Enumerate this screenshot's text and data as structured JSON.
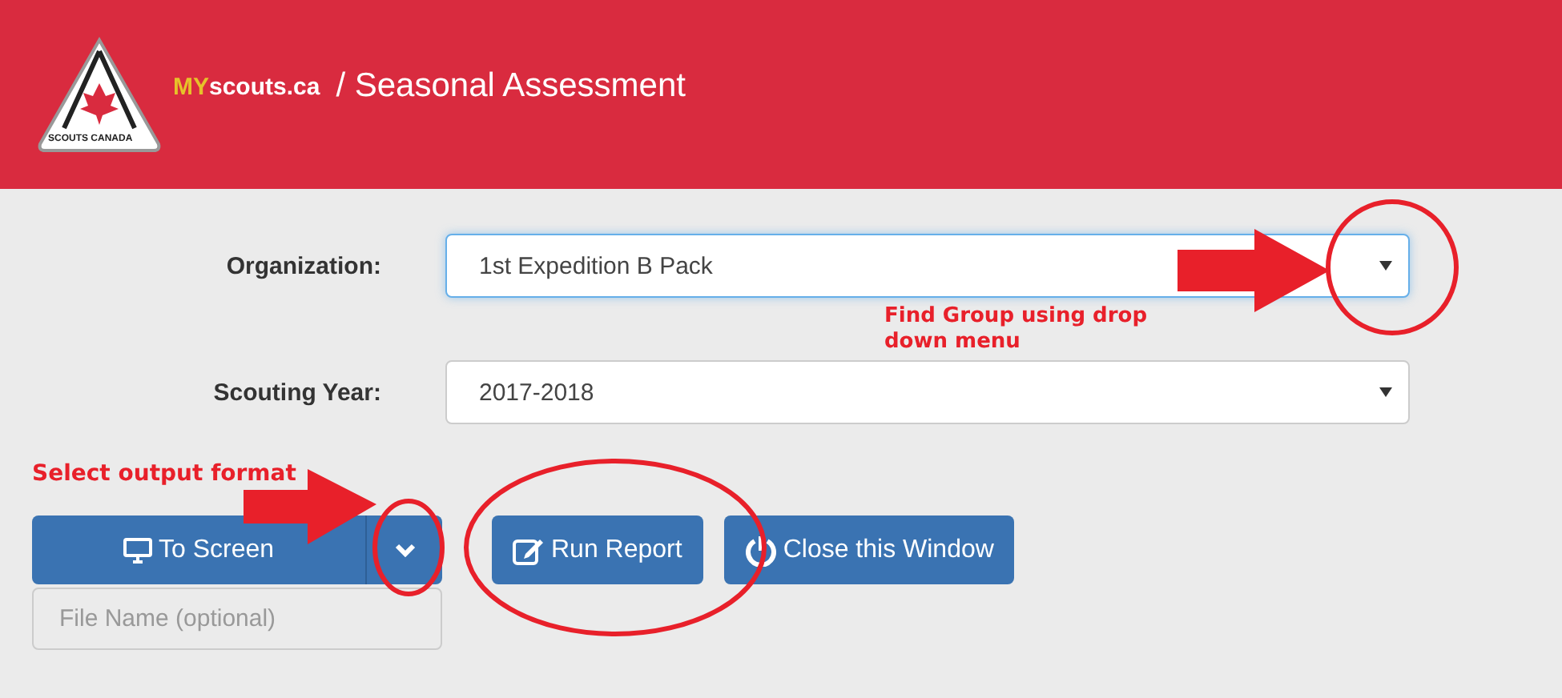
{
  "header": {
    "logo": {
      "badge_text": "SCOUTS CANADA",
      "brand_prefix": "MY",
      "brand_suffix": "scouts.ca"
    },
    "title": "/ Seasonal Assessment"
  },
  "fields": [
    {
      "label": "Organization:",
      "value": "1st Expedition B Pack",
      "focused": true
    },
    {
      "label": "Scouting Year:",
      "value": "2017-2018",
      "focused": false
    }
  ],
  "output_button": {
    "label": "To Screen"
  },
  "buttons": [
    {
      "label": "Run Report",
      "kind": "edit"
    },
    {
      "label": "Close this Window",
      "kind": "power"
    }
  ],
  "file_name": {
    "placeholder": "File Name (optional)"
  },
  "annotations": [
    {
      "text": "Find Group using drop down menu",
      "kind": "organization"
    },
    {
      "text": "Select output format",
      "kind": "output"
    }
  ]
}
